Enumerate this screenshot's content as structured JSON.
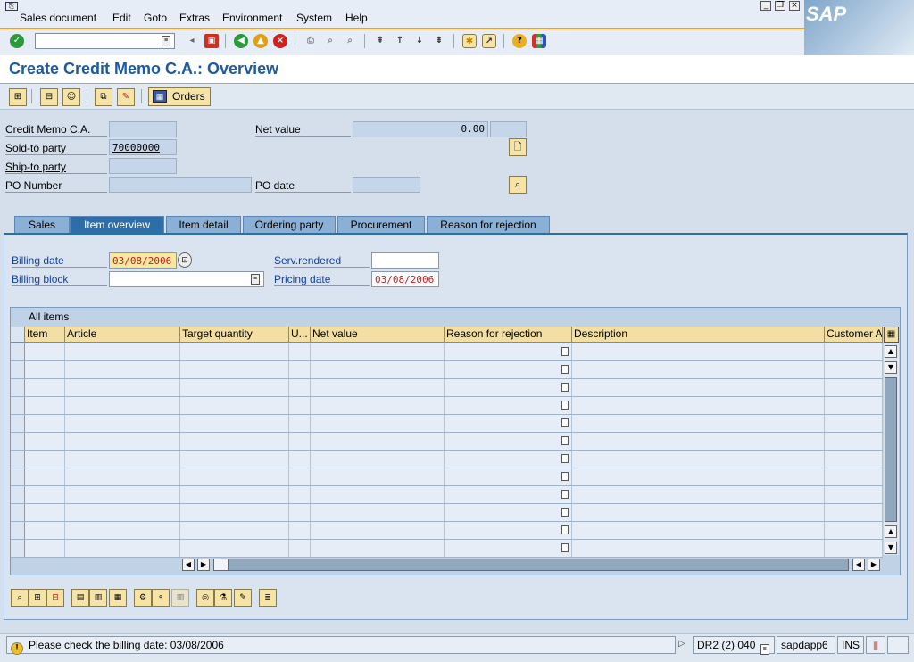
{
  "menu": {
    "items": [
      "Sales document",
      "Edit",
      "Goto",
      "Extras",
      "Environment",
      "System",
      "Help"
    ]
  },
  "brand": {
    "logo_text": "SAP"
  },
  "toolbar": {
    "command_value": ""
  },
  "page": {
    "title": "Create Credit Memo C.A.: Overview"
  },
  "app_toolbar": {
    "orders_label": "Orders"
  },
  "header": {
    "credit_memo_label": "Credit Memo C.A.",
    "credit_memo_value": "",
    "net_value_label": "Net value",
    "net_value_value": "0.00",
    "currency_value": "",
    "sold_to_label": "Sold-to party",
    "sold_to_value": "70000000",
    "ship_to_label": "Ship-to party",
    "ship_to_value": "",
    "po_number_label": "PO Number",
    "po_number_value": "",
    "po_date_label": "PO date",
    "po_date_value": ""
  },
  "tabs": [
    {
      "label": "Sales",
      "active": false
    },
    {
      "label": "Item overview",
      "active": true
    },
    {
      "label": "Item detail",
      "active": false
    },
    {
      "label": "Ordering party",
      "active": false
    },
    {
      "label": "Procurement",
      "active": false
    },
    {
      "label": "Reason for rejection",
      "active": false
    }
  ],
  "item_overview": {
    "billing_date_label": "Billing date",
    "billing_date_value": "03/08/2006",
    "billing_block_label": "Billing block",
    "billing_block_value": "",
    "serv_rendered_label": "Serv.rendered",
    "serv_rendered_value": "",
    "pricing_date_label": "Pricing date",
    "pricing_date_value": "03/08/2006"
  },
  "grid": {
    "title": "All items",
    "columns": [
      "Item",
      "Article",
      "Target quantity",
      "U...",
      "Net value",
      "Reason for rejection",
      "Description",
      "Customer A"
    ],
    "row_count": 12
  },
  "status": {
    "message": "Please check the billing date: 03/08/2006",
    "system": "DR2 (2) 040",
    "server": "sapdapp6",
    "mode": "INS"
  },
  "colors": {
    "title": "#1e5aa0",
    "active_tab": "#2e6ea8",
    "button_bg": "#f6e3a6",
    "date_highlight": "#f8e7a0",
    "error_text": "#c02020"
  }
}
